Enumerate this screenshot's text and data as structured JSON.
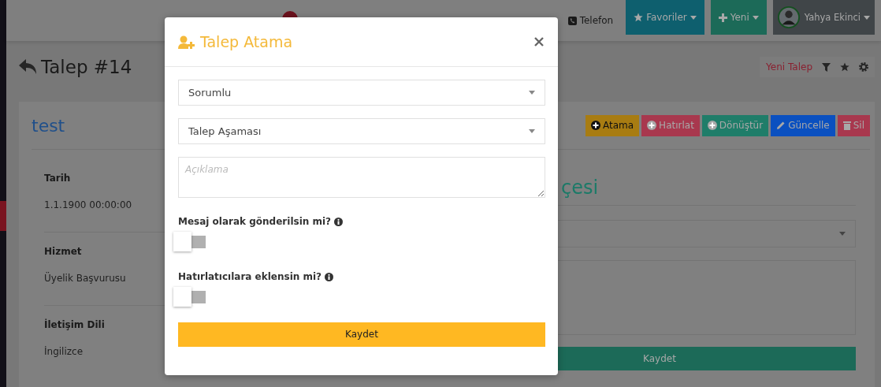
{
  "navbar": {
    "phone_link": "Telefon",
    "buttons": [
      {
        "label": "Favoriler",
        "kind": "favorites",
        "color": "#0e5f6e"
      },
      {
        "label": "Yeni",
        "kind": "new",
        "color": "#1c6a58"
      }
    ],
    "user": {
      "name": "Yahya Ekinci"
    }
  },
  "page": {
    "title": "Talep #14",
    "toolbar_link": "Yeni Talep"
  },
  "card": {
    "title": "test",
    "actions": [
      {
        "label": "Atama",
        "kind": "add",
        "color": "#a87c12"
      },
      {
        "label": "Hatırlat",
        "kind": "add",
        "color": "#a8384e"
      },
      {
        "label": "Dönüştür",
        "kind": "add",
        "color": "#1f7d69"
      },
      {
        "label": "Güncelle",
        "kind": "edit",
        "color": "#0a50c0"
      },
      {
        "label": "Sil",
        "kind": "delete",
        "color": "#a8384e"
      }
    ],
    "fields": [
      {
        "label": "Tarih",
        "value": "1.1.1900 00:00:00"
      },
      {
        "label": "Hizmet",
        "value": "Üyelik Başvurusu"
      },
      {
        "label": "İletişim Dili",
        "value": "İngilizce"
      }
    ],
    "side_panel": {
      "title": "çesi",
      "button": "Kaydet"
    }
  },
  "modal": {
    "title": "Talep Atama",
    "selects": [
      {
        "value": "Sorumlu"
      },
      {
        "value": "Talep Aşaması"
      }
    ],
    "textarea": {
      "placeholder": "Açıklama"
    },
    "toggles": [
      {
        "label": "Mesaj olarak gönderilsin mi?",
        "on": false
      },
      {
        "label": "Hatırlatıcılara eklensin mi?",
        "on": false
      }
    ],
    "submit": "Kaydet"
  }
}
